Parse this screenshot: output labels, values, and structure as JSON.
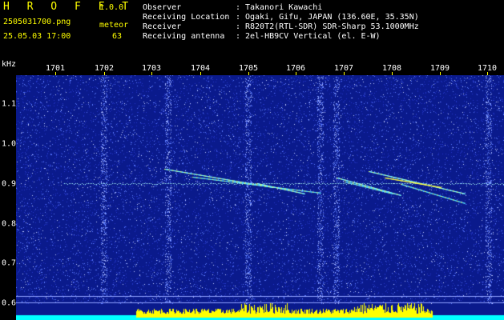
{
  "header": {
    "app_title": "H R O F F T",
    "app_version": "1.0.0",
    "filename": "2505031700.png",
    "datetime": "25.05.03 17:00",
    "meteor_label": "meteor",
    "meteor_count": "63"
  },
  "station": {
    "rows": [
      {
        "key": "Observer",
        "sep": ":",
        "value": "Takanori Kawachi"
      },
      {
        "key": "Receiving Location",
        "sep": ":",
        "value": "Ogaki, Gifu, JAPAN (136.60E, 35.35N)"
      },
      {
        "key": "Receiver",
        "sep": ":",
        "value": "R820T2(RTL-SDR) SDR-Sharp 53.1000MHz"
      },
      {
        "key": "Receiving antenna",
        "sep": ":",
        "value": "2el-HB9CV Vertical (el. E-W)"
      }
    ]
  },
  "axes": {
    "y_unit": "kHz",
    "time_labels": [
      "1701",
      "1702",
      "1703",
      "1704",
      "1705",
      "1706",
      "1707",
      "1708",
      "1709",
      "1710"
    ],
    "freq_labels": [
      "1.1",
      "1.0",
      "0.9",
      "0.8",
      "0.7",
      "0.6"
    ]
  },
  "colors": {
    "background_blue": "#0a1a8c",
    "noise_light": "#5a7bff",
    "echo_cyan": "#7fffff",
    "echo_yellow": "#ffff40",
    "carrier": "#aaffff",
    "level_yellow": "#ffff00",
    "level_cyan": "#00ffff"
  }
}
